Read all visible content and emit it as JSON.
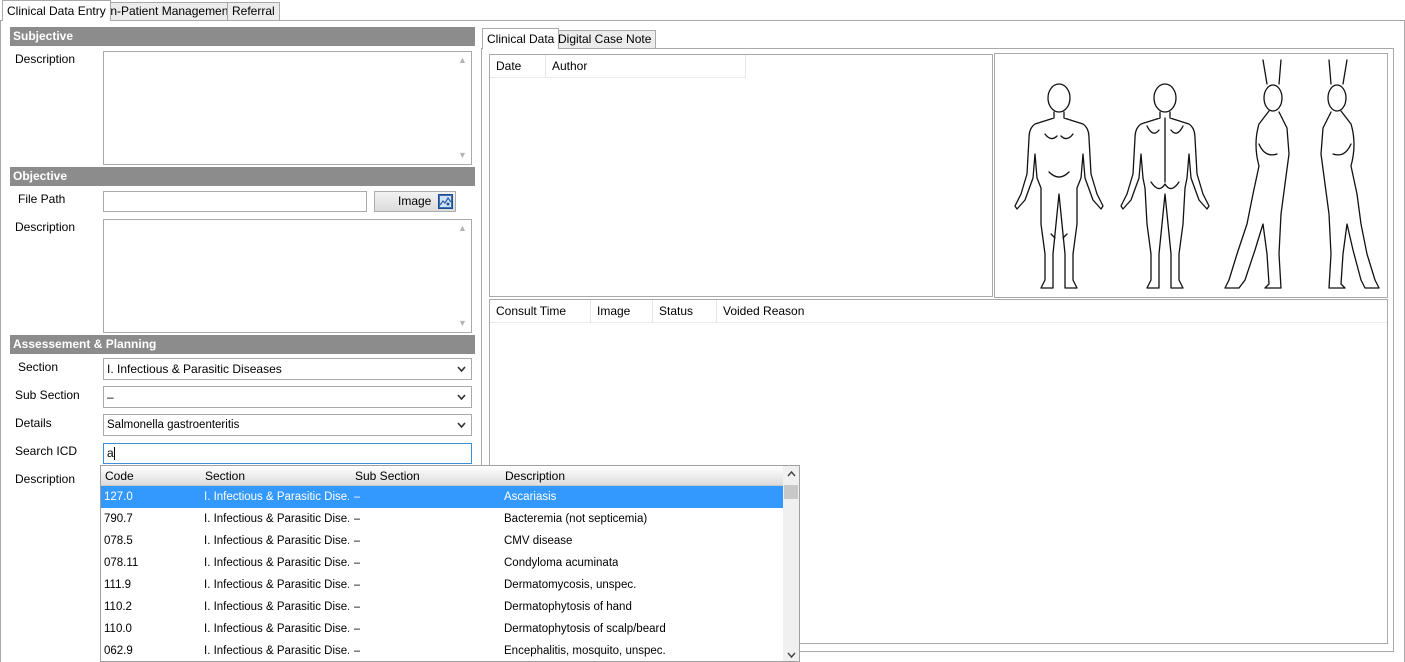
{
  "top_tabs": [
    {
      "label": "Clinical Data Entry",
      "active": true
    },
    {
      "label": "In-Patient Management",
      "active": false
    },
    {
      "label": "Referral",
      "active": false
    }
  ],
  "subjective": {
    "header": "Subjective",
    "description_label": "Description",
    "description_value": ""
  },
  "objective": {
    "header": "Objective",
    "file_path_label": "File Path",
    "file_path_value": "",
    "image_button_label": "Image",
    "description_label": "Description",
    "description_value": ""
  },
  "assessment": {
    "header": "Assessement & Planning",
    "section_label": "Section",
    "section_value": "I. Infectious & Parasitic Diseases",
    "sub_section_label": "Sub Section",
    "sub_section_value": "–",
    "details_label": "Details",
    "details_value": "Salmonella gastroenteritis",
    "search_icd_label": "Search ICD",
    "search_icd_value": "a",
    "description_label": "Description"
  },
  "right_tabs": [
    {
      "label": "Clinical Data",
      "active": true
    },
    {
      "label": "Digital Case Note",
      "active": false
    }
  ],
  "clinical_grid": {
    "columns": [
      "Date",
      "Author"
    ]
  },
  "consult_grid": {
    "columns": [
      "Consult Time",
      "Image",
      "Status",
      "Voided Reason"
    ]
  },
  "icd_popup": {
    "columns": [
      "Code",
      "Section",
      "Sub Section",
      "Description"
    ],
    "rows": [
      {
        "code": "127.0",
        "section": "I. Infectious & Parasitic Dise...",
        "sub_section": "–",
        "description": "Ascariasis"
      },
      {
        "code": "790.7",
        "section": "I. Infectious & Parasitic Dise...",
        "sub_section": "–",
        "description": "Bacteremia (not septicemia)"
      },
      {
        "code": "078.5",
        "section": "I. Infectious & Parasitic Dise...",
        "sub_section": "–",
        "description": "CMV disease"
      },
      {
        "code": "078.11",
        "section": "I. Infectious & Parasitic Dise...",
        "sub_section": "–",
        "description": "Condyloma acuminata"
      },
      {
        "code": "111.9",
        "section": "I. Infectious & Parasitic Dise...",
        "sub_section": "–",
        "description": "Dermatomycosis, unspec."
      },
      {
        "code": "110.2",
        "section": "I. Infectious & Parasitic Dise...",
        "sub_section": "–",
        "description": "Dermatophytosis of hand"
      },
      {
        "code": "110.0",
        "section": "I. Infectious & Parasitic Dise...",
        "sub_section": "–",
        "description": "Dermatophytosis of scalp/beard"
      },
      {
        "code": "062.9",
        "section": "I. Infectious & Parasitic Dise...",
        "sub_section": "–",
        "description": "Encephalitis, mosquito, unspec."
      }
    ]
  },
  "colors": {
    "section_header_bg": "#8c8c8c",
    "selection": "#3399ff",
    "border": "#a9a9a9"
  },
  "icons": {
    "image_button_icon": "image-icon",
    "dropdown_icon": "chevron-down-icon",
    "body_chart": "body-chart-image"
  }
}
